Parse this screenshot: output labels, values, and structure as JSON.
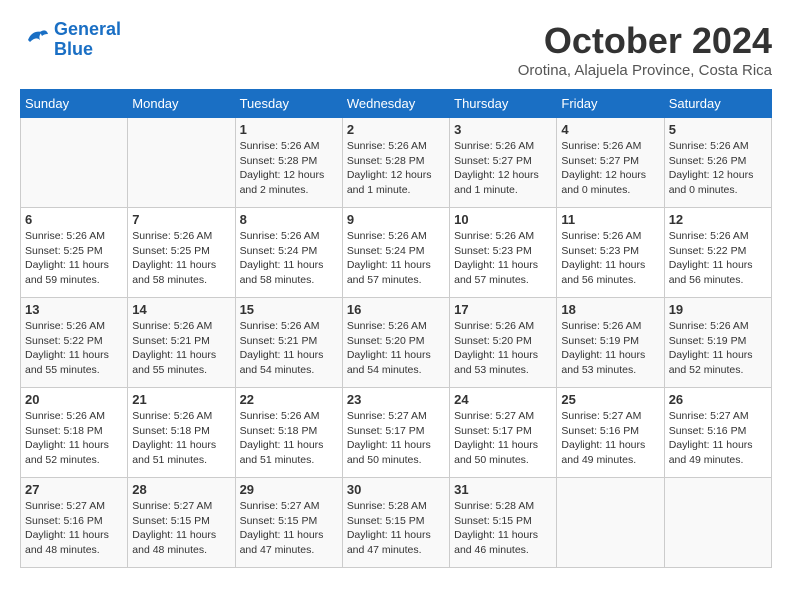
{
  "logo": {
    "line1": "General",
    "line2": "Blue"
  },
  "title": "October 2024",
  "subtitle": "Orotina, Alajuela Province, Costa Rica",
  "weekdays": [
    "Sunday",
    "Monday",
    "Tuesday",
    "Wednesday",
    "Thursday",
    "Friday",
    "Saturday"
  ],
  "weeks": [
    [
      {
        "day": "",
        "info": ""
      },
      {
        "day": "",
        "info": ""
      },
      {
        "day": "1",
        "info": "Sunrise: 5:26 AM\nSunset: 5:28 PM\nDaylight: 12 hours\nand 2 minutes."
      },
      {
        "day": "2",
        "info": "Sunrise: 5:26 AM\nSunset: 5:28 PM\nDaylight: 12 hours\nand 1 minute."
      },
      {
        "day": "3",
        "info": "Sunrise: 5:26 AM\nSunset: 5:27 PM\nDaylight: 12 hours\nand 1 minute."
      },
      {
        "day": "4",
        "info": "Sunrise: 5:26 AM\nSunset: 5:27 PM\nDaylight: 12 hours\nand 0 minutes."
      },
      {
        "day": "5",
        "info": "Sunrise: 5:26 AM\nSunset: 5:26 PM\nDaylight: 12 hours\nand 0 minutes."
      }
    ],
    [
      {
        "day": "6",
        "info": "Sunrise: 5:26 AM\nSunset: 5:25 PM\nDaylight: 11 hours\nand 59 minutes."
      },
      {
        "day": "7",
        "info": "Sunrise: 5:26 AM\nSunset: 5:25 PM\nDaylight: 11 hours\nand 58 minutes."
      },
      {
        "day": "8",
        "info": "Sunrise: 5:26 AM\nSunset: 5:24 PM\nDaylight: 11 hours\nand 58 minutes."
      },
      {
        "day": "9",
        "info": "Sunrise: 5:26 AM\nSunset: 5:24 PM\nDaylight: 11 hours\nand 57 minutes."
      },
      {
        "day": "10",
        "info": "Sunrise: 5:26 AM\nSunset: 5:23 PM\nDaylight: 11 hours\nand 57 minutes."
      },
      {
        "day": "11",
        "info": "Sunrise: 5:26 AM\nSunset: 5:23 PM\nDaylight: 11 hours\nand 56 minutes."
      },
      {
        "day": "12",
        "info": "Sunrise: 5:26 AM\nSunset: 5:22 PM\nDaylight: 11 hours\nand 56 minutes."
      }
    ],
    [
      {
        "day": "13",
        "info": "Sunrise: 5:26 AM\nSunset: 5:22 PM\nDaylight: 11 hours\nand 55 minutes."
      },
      {
        "day": "14",
        "info": "Sunrise: 5:26 AM\nSunset: 5:21 PM\nDaylight: 11 hours\nand 55 minutes."
      },
      {
        "day": "15",
        "info": "Sunrise: 5:26 AM\nSunset: 5:21 PM\nDaylight: 11 hours\nand 54 minutes."
      },
      {
        "day": "16",
        "info": "Sunrise: 5:26 AM\nSunset: 5:20 PM\nDaylight: 11 hours\nand 54 minutes."
      },
      {
        "day": "17",
        "info": "Sunrise: 5:26 AM\nSunset: 5:20 PM\nDaylight: 11 hours\nand 53 minutes."
      },
      {
        "day": "18",
        "info": "Sunrise: 5:26 AM\nSunset: 5:19 PM\nDaylight: 11 hours\nand 53 minutes."
      },
      {
        "day": "19",
        "info": "Sunrise: 5:26 AM\nSunset: 5:19 PM\nDaylight: 11 hours\nand 52 minutes."
      }
    ],
    [
      {
        "day": "20",
        "info": "Sunrise: 5:26 AM\nSunset: 5:18 PM\nDaylight: 11 hours\nand 52 minutes."
      },
      {
        "day": "21",
        "info": "Sunrise: 5:26 AM\nSunset: 5:18 PM\nDaylight: 11 hours\nand 51 minutes."
      },
      {
        "day": "22",
        "info": "Sunrise: 5:26 AM\nSunset: 5:18 PM\nDaylight: 11 hours\nand 51 minutes."
      },
      {
        "day": "23",
        "info": "Sunrise: 5:27 AM\nSunset: 5:17 PM\nDaylight: 11 hours\nand 50 minutes."
      },
      {
        "day": "24",
        "info": "Sunrise: 5:27 AM\nSunset: 5:17 PM\nDaylight: 11 hours\nand 50 minutes."
      },
      {
        "day": "25",
        "info": "Sunrise: 5:27 AM\nSunset: 5:16 PM\nDaylight: 11 hours\nand 49 minutes."
      },
      {
        "day": "26",
        "info": "Sunrise: 5:27 AM\nSunset: 5:16 PM\nDaylight: 11 hours\nand 49 minutes."
      }
    ],
    [
      {
        "day": "27",
        "info": "Sunrise: 5:27 AM\nSunset: 5:16 PM\nDaylight: 11 hours\nand 48 minutes."
      },
      {
        "day": "28",
        "info": "Sunrise: 5:27 AM\nSunset: 5:15 PM\nDaylight: 11 hours\nand 48 minutes."
      },
      {
        "day": "29",
        "info": "Sunrise: 5:27 AM\nSunset: 5:15 PM\nDaylight: 11 hours\nand 47 minutes."
      },
      {
        "day": "30",
        "info": "Sunrise: 5:28 AM\nSunset: 5:15 PM\nDaylight: 11 hours\nand 47 minutes."
      },
      {
        "day": "31",
        "info": "Sunrise: 5:28 AM\nSunset: 5:15 PM\nDaylight: 11 hours\nand 46 minutes."
      },
      {
        "day": "",
        "info": ""
      },
      {
        "day": "",
        "info": ""
      }
    ]
  ]
}
